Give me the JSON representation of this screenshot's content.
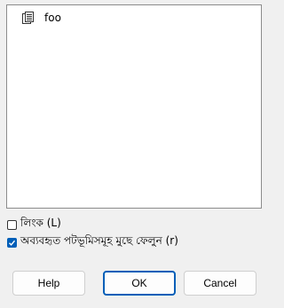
{
  "list": {
    "items": [
      {
        "label": "foo",
        "icon": "document-icon"
      }
    ]
  },
  "options": {
    "link_label": "লিংক (L)",
    "link_checked": false,
    "remove_unused_label": "অব্যবহৃত পটভূমিসমূহ মুছে ফেলুন (r)",
    "remove_unused_checked": true
  },
  "buttons": {
    "help_label": "Help",
    "ok_label": "OK",
    "cancel_label": "Cancel"
  },
  "colors": {
    "accent": "#005fb8",
    "background": "#f0f0f0"
  }
}
